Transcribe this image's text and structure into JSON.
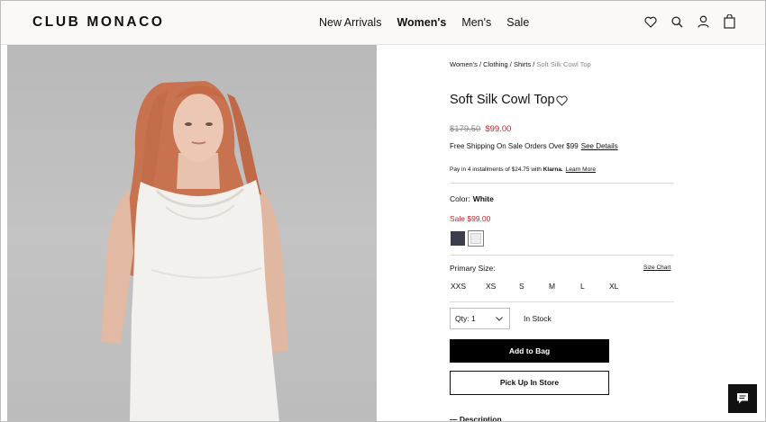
{
  "header": {
    "logo": "CLUB MONACO",
    "nav": [
      "New Arrivals",
      "Women's",
      "Men's",
      "Sale"
    ],
    "active_nav": "Women's",
    "icons": [
      "heart-icon",
      "search-icon",
      "account-icon",
      "bag-icon"
    ]
  },
  "product": {
    "breadcrumb": {
      "crumb1": "Women's",
      "sep1": " / ",
      "crumb2": "Clothing",
      "sep2": " / ",
      "crumb3": "Shirts",
      "sep3": " / ",
      "current": "Soft Silk Cowl Top"
    },
    "title": "Soft Silk Cowl Top",
    "original_price": "$179.50",
    "sale_price": "$99.00",
    "shipping_text": "Free Shipping On Sale Orders Over $99",
    "shipping_link": "See Details",
    "klarna_prefix": "Pay in 4 installments of $24.75 with",
    "klarna_brand": "Klarna.",
    "klarna_link": "Learn More",
    "color_label": "Color:",
    "color_value": "White",
    "sale_label": "Sale $99.00",
    "swatches": [
      "navy",
      "white"
    ],
    "selected_swatch": "white",
    "size_label": "Primary Size:",
    "size_chart": "Size Chart",
    "sizes": [
      "XXS",
      "XS",
      "S",
      "M",
      "L",
      "XL"
    ],
    "qty_label": "Qty: 1",
    "stock_status": "In Stock",
    "add_to_bag": "Add to Bag",
    "pick_up": "Pick Up In Store",
    "description_label": "Description",
    "description_marker": "—"
  },
  "colors": {
    "sale_red": "#c0272d",
    "swatch_navy": "#3a3e4d",
    "swatch_white": "#ececec",
    "button_black": "#000000",
    "header_bg": "#faf9f6"
  }
}
